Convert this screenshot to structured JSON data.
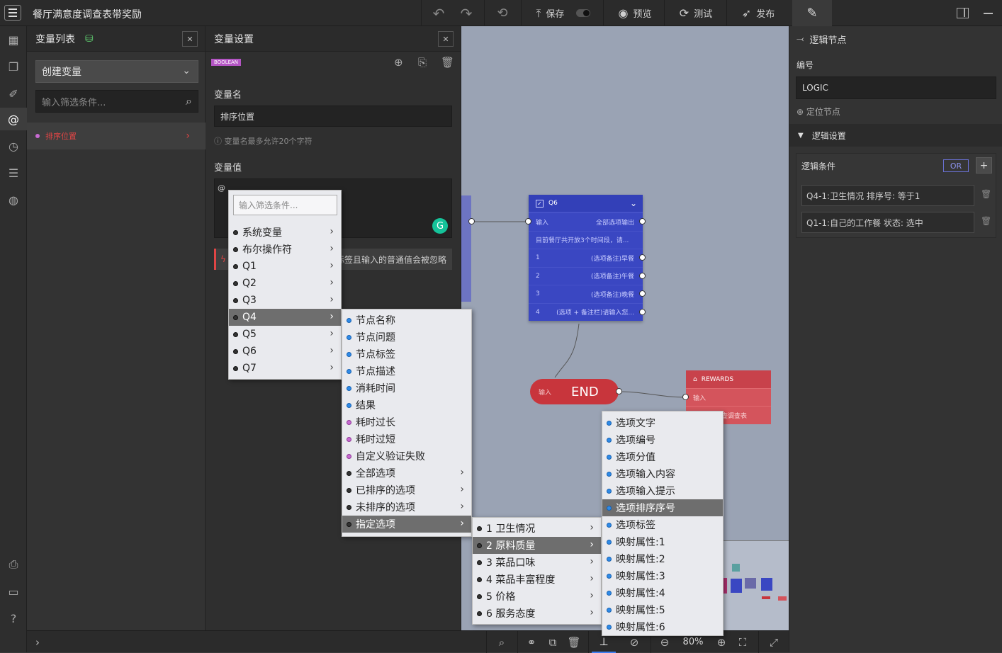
{
  "app": {
    "title": "餐厅满意度调查表带奖励"
  },
  "toolbar": {
    "undo": "↶",
    "redo": "↷",
    "reset": "⟲",
    "save": "保存",
    "preview": "预览",
    "test": "测试",
    "publish": "发布"
  },
  "varlist": {
    "title": "变量列表",
    "create": "创建变量",
    "filter_placeholder": "输入筛选条件...",
    "items": [
      {
        "label": "排序位置"
      }
    ]
  },
  "varset": {
    "title": "变量设置",
    "type_badge": "BOOLEAN",
    "name_label": "变量名",
    "name_value": "排序位置",
    "name_hint": "变量名最多允许20个字符",
    "value_label": "变量值",
    "value_text": "@",
    "warning": "标签且输入的普通值会被忽略"
  },
  "menu1": {
    "filter_placeholder": "输入筛选条件...",
    "items": [
      "系统变量",
      "布尔操作符",
      "Q1",
      "Q2",
      "Q3",
      "Q4",
      "Q5",
      "Q6",
      "Q7"
    ]
  },
  "menu2": {
    "items": [
      "节点名称",
      "节点问题",
      "节点标签",
      "节点描述",
      "消耗时间",
      "结果",
      "耗时过长",
      "耗时过短",
      "自定义验证失败",
      "全部选项",
      "已排序的选项",
      "未排序的选项",
      "指定选项"
    ]
  },
  "menu3": {
    "items": [
      "1 卫生情况",
      "2 原料质量",
      "3 菜品口味",
      "4 菜品丰富程度",
      "5 价格",
      "6 服务态度"
    ]
  },
  "menu4": {
    "items": [
      "选项文字",
      "选项编号",
      "选项分值",
      "选项输入内容",
      "选项输入提示",
      "选项排序序号",
      "选项标签",
      "映射属性:1",
      "映射属性:2",
      "映射属性:3",
      "映射属性:4",
      "映射属性:5",
      "映射属性:6"
    ]
  },
  "q6": {
    "title": "Q6",
    "in": "输入",
    "out_all": "全部选项输出",
    "desc": "目前餐厅共开放3个时间段，请...",
    "opts": [
      {
        "n": "1",
        "t": "(选项备注)早餐"
      },
      {
        "n": "2",
        "t": "(选项备注)午餐"
      },
      {
        "n": "3",
        "t": "(选项备注)晚餐"
      },
      {
        "n": "4",
        "t": "(选项 + 备注栏)请输入您..."
      }
    ]
  },
  "endnode": {
    "in": "输入",
    "label": "END"
  },
  "rewards": {
    "title": "REWARDS",
    "in": "输入",
    "text": "查调查表"
  },
  "right": {
    "title": "逻辑节点",
    "id_label": "编号",
    "id_value": "LOGIC",
    "locate": "定位节点",
    "section": "逻辑设置",
    "cond_label": "逻辑条件",
    "or": "OR",
    "plus": "+",
    "conditions": [
      "Q4-1:卫生情况 排序号: 等于1",
      "Q1-1:自己的工作餐 状态: 选中"
    ]
  },
  "zoom": "80%",
  "colors": {
    "bg": "#3a3a3a",
    "canvas": "#9aa3b4",
    "node_blue": "#3a47c2",
    "node_red": "#c8353c",
    "accent_red": "#e04545",
    "badge": "#b455c4"
  }
}
